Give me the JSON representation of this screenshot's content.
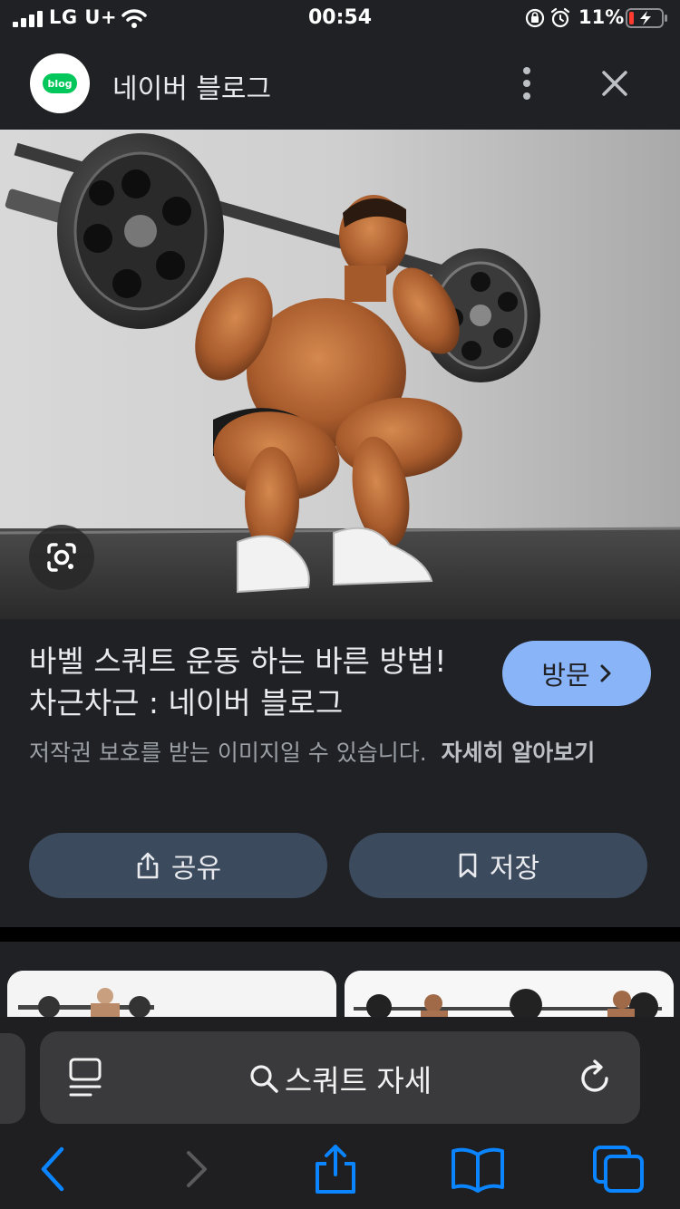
{
  "status_bar": {
    "carrier": "LG U+",
    "time": "00:54",
    "battery_percent": "11%",
    "icons": [
      "cellular-signal-icon",
      "wifi-icon",
      "rotation-lock-icon",
      "alarm-icon",
      "battery-charging-icon"
    ]
  },
  "header": {
    "logo_text": "blog",
    "title": "네이버 블로그",
    "icons": [
      "more-vertical-icon",
      "close-icon"
    ]
  },
  "image": {
    "lens_icon": "google-lens-icon"
  },
  "result": {
    "title": "바벨 스쿼트 운동 하는 바른 방법! 차근차근 : 네이버 블로그",
    "visit_label": "방문",
    "copyright_text": "저작권 보호를 받는 이미지일 수 있습니다.",
    "learn_more_label": "자세히 알아보기",
    "share_label": "공유",
    "save_label": "저장"
  },
  "safari": {
    "search_query": "스쿼트 자세",
    "icons": [
      "reader-icon",
      "search-icon",
      "reload-icon",
      "back-icon",
      "forward-icon",
      "share-icon",
      "bookmarks-icon",
      "tabs-icon"
    ]
  },
  "colors": {
    "background": "#202124",
    "visit_button": "#8ab4f8",
    "action_button": "#3c4a5e",
    "safari_blue": "#0a84ff",
    "naver_green": "#03c75a",
    "battery_low": "#ff3b30"
  }
}
